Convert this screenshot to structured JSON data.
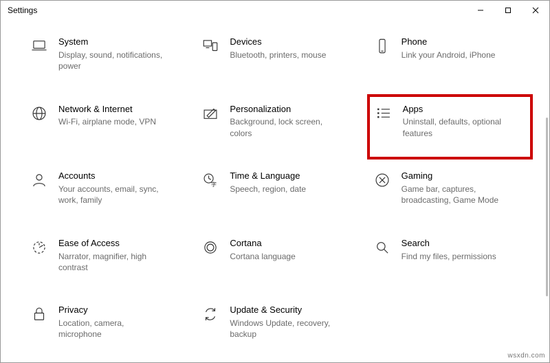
{
  "window": {
    "title": "Settings"
  },
  "tiles": [
    {
      "title": "System",
      "desc": "Display, sound, notifications, power",
      "icon": "laptop",
      "highlight": false
    },
    {
      "title": "Devices",
      "desc": "Bluetooth, printers, mouse",
      "icon": "devices",
      "highlight": false
    },
    {
      "title": "Phone",
      "desc": "Link your Android, iPhone",
      "icon": "phone",
      "highlight": false
    },
    {
      "title": "Network & Internet",
      "desc": "Wi-Fi, airplane mode, VPN",
      "icon": "globe",
      "highlight": false
    },
    {
      "title": "Personalization",
      "desc": "Background, lock screen, colors",
      "icon": "pen",
      "highlight": false
    },
    {
      "title": "Apps",
      "desc": "Uninstall, defaults, optional features",
      "icon": "apps",
      "highlight": true
    },
    {
      "title": "Accounts",
      "desc": "Your accounts, email, sync, work, family",
      "icon": "account",
      "highlight": false
    },
    {
      "title": "Time & Language",
      "desc": "Speech, region, date",
      "icon": "time-lang",
      "highlight": false
    },
    {
      "title": "Gaming",
      "desc": "Game bar, captures, broadcasting, Game Mode",
      "icon": "gaming",
      "highlight": false
    },
    {
      "title": "Ease of Access",
      "desc": "Narrator, magnifier, high contrast",
      "icon": "ease",
      "highlight": false
    },
    {
      "title": "Cortana",
      "desc": "Cortana language",
      "icon": "cortana",
      "highlight": false
    },
    {
      "title": "Search",
      "desc": "Find my files, permissions",
      "icon": "search",
      "highlight": false
    },
    {
      "title": "Privacy",
      "desc": "Location, camera, microphone",
      "icon": "privacy",
      "highlight": false
    },
    {
      "title": "Update & Security",
      "desc": "Windows Update, recovery, backup",
      "icon": "update",
      "highlight": false
    }
  ],
  "watermark": "wsxdn.com"
}
